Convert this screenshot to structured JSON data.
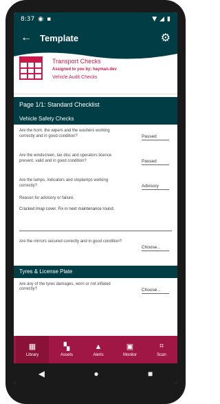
{
  "status": {
    "time": "8:37",
    "signal_icon": "signal-icon",
    "wifi_icon": "wifi-icon",
    "battery_icon": "battery-icon"
  },
  "appbar": {
    "title": "Template"
  },
  "header": {
    "title": "Transport Checks",
    "assigned": "Assigned to you by: hayman.dev",
    "subtitle": "Vehicle Audit Checks"
  },
  "page_title": "Page 1/1: Standard Checklist",
  "sections": [
    {
      "title": "Vehicle Safety Checks",
      "questions": [
        {
          "text": "Are the horn, the wipers and the washers working correctly and in good condition?",
          "answer": "Passed"
        },
        {
          "text": "Are the windscreen, tax disc and operators licence present, valid and in good condition?",
          "answer": "Passed"
        },
        {
          "text": "Are the lamps, indicators and stoplamps working correctly?",
          "answer": "Advisory",
          "reason_label": "Reason for advisory or failure.",
          "reason_value": "Cracked lmap cover. Fix in next maintenance round."
        },
        {
          "text": "Are the mirrors secured correctly and in good condition?",
          "answer": "Choose..."
        }
      ]
    },
    {
      "title": "Tyres & License Plate",
      "questions": [
        {
          "text": "Are any of the tyres damages, worn or not inflated correctly?",
          "answer": "Choose..."
        }
      ]
    }
  ],
  "nav": [
    {
      "label": "Library",
      "icon": "library-icon"
    },
    {
      "label": "Assets",
      "icon": "assets-icon"
    },
    {
      "label": "Alerts",
      "icon": "alerts-icon"
    },
    {
      "label": "Monitor",
      "icon": "monitor-icon"
    },
    {
      "label": "Scan",
      "icon": "scan-icon"
    }
  ],
  "colors": {
    "primary": "#003d45",
    "accent": "#c8194a",
    "nav": "#a01745"
  }
}
